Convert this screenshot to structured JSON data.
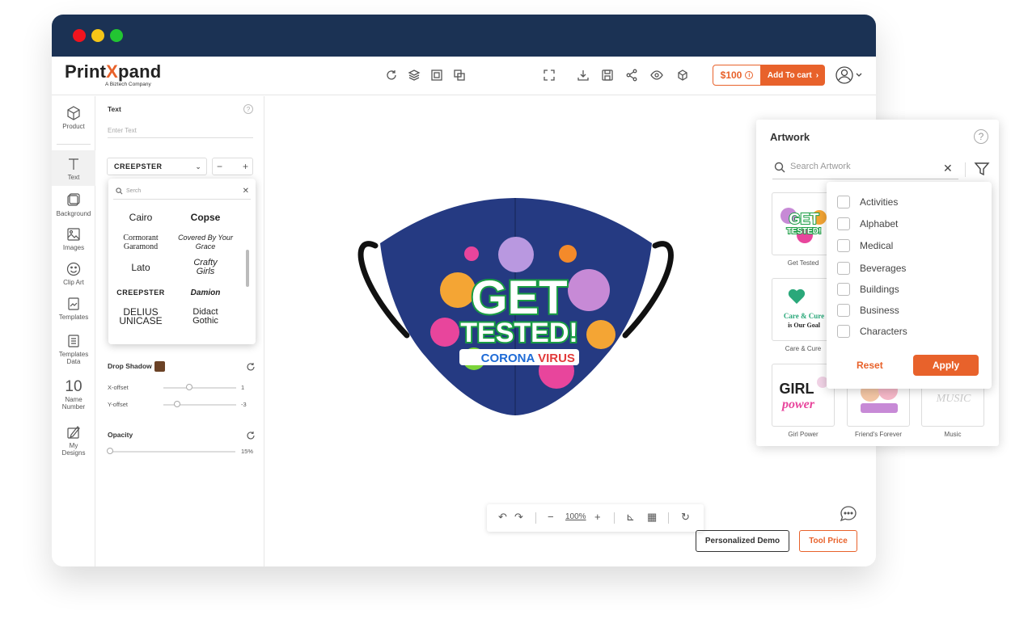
{
  "brand": {
    "name_a": "Print",
    "name_x": "X",
    "name_b": "pand",
    "subtitle": "A Biztech Company"
  },
  "topbar": {
    "price": "$100",
    "add_to_cart": "Add To cart",
    "icons": [
      "reset-icon",
      "layers-icon",
      "add-layer-icon",
      "duplicate-icon",
      "fullscreen-icon",
      "download-icon",
      "save-icon",
      "share-icon",
      "preview-icon",
      "3d-icon",
      "user-icon"
    ]
  },
  "nav": {
    "items": [
      {
        "label": "Product",
        "icon": "cube-icon"
      },
      {
        "label": "Text",
        "icon": "text-icon"
      },
      {
        "label": "Background",
        "icon": "background-icon"
      },
      {
        "label": "Images",
        "icon": "image-icon"
      },
      {
        "label": "Clip Art",
        "icon": "smiley-icon"
      },
      {
        "label": "Templates",
        "icon": "templates-icon"
      },
      {
        "label": "Templates Data",
        "icon": "templates-data-icon"
      },
      {
        "label": "Name Number",
        "icon": "number-icon",
        "glyph": "10"
      },
      {
        "label": "My Designs",
        "icon": "designs-icon"
      }
    ]
  },
  "props": {
    "text_label": "Text",
    "text_placeholder": "Enter Text",
    "font_selected": "CREEPSTER",
    "drop_shadow_label": "Drop Shadow",
    "drop_shadow_color": "#6b4226",
    "x_offset_label": "X-offset",
    "x_offset_value": "1",
    "y_offset_label": "Y-offset",
    "y_offset_value": "-3",
    "opacity_label": "Opacity",
    "opacity_value": "15%"
  },
  "font_dropdown": {
    "search_placeholder": "Serch",
    "fonts": [
      [
        "Cairo",
        "Copse"
      ],
      [
        "Cormorant Garamond",
        "Covered By Your Grace"
      ],
      [
        "Lato",
        "Crafty Girls"
      ],
      [
        "CREEPSTER",
        "Damion"
      ],
      [
        "DELIUS UNICASE",
        "Didact Gothic"
      ]
    ]
  },
  "canvas": {
    "zoom": "100%",
    "personalized_demo": "Personalized Demo",
    "tool_price": "Tool Price",
    "mask_text": {
      "line1": "GET",
      "line2": "TESTED!",
      "line3a": "CORONA",
      "line3b": "VIRUS"
    }
  },
  "artwork": {
    "title": "Artwork",
    "search_placeholder": "Search Artwork",
    "items": [
      {
        "label": "Get Tested"
      },
      {
        "label": "Care & Cure"
      },
      {
        "label": "Girl Power"
      },
      {
        "label": "Friend's Forever"
      },
      {
        "label": "Music"
      }
    ],
    "thumb_text": {
      "get": "GET",
      "tested": "TESTED!",
      "care1": "Care & Cure",
      "care2": "is Our Goal",
      "girl": "GIRL",
      "power": "power",
      "music": "MUSIC"
    }
  },
  "filter": {
    "categories": [
      "Activities",
      "Alphabet",
      "Medical",
      "Beverages",
      "Buildings",
      "Business",
      "Characters"
    ],
    "reset": "Reset",
    "apply": "Apply"
  },
  "colors": {
    "accent": "#e8622b",
    "titlebar": "#1b3254",
    "mask": "#253a82"
  }
}
